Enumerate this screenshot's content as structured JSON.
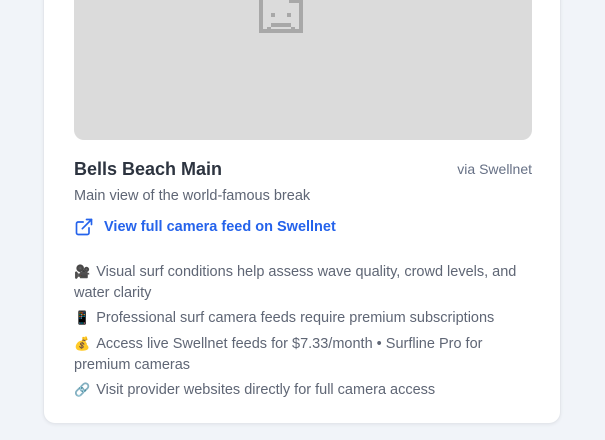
{
  "camera": {
    "name": "Bells Beach Main",
    "provider": "via Swellnet",
    "description": "Main view of the world-famous break",
    "link_label": "View full camera feed on Swellnet"
  },
  "notes": [
    {
      "icon": "video-camera-icon",
      "glyph": "🎥",
      "text": "Visual surf conditions help assess wave quality, crowd levels, and water clarity"
    },
    {
      "icon": "mobile-phone-icon",
      "glyph": "📱",
      "text": "Professional surf camera feeds require premium subscriptions"
    },
    {
      "icon": "money-bag-icon",
      "glyph": "💰",
      "text": "Access live Swellnet feeds for $7.33/month • Surfline Pro for premium cameras"
    },
    {
      "icon": "link-icon",
      "glyph": "🔗",
      "text": "Visit provider websites directly for full camera access"
    }
  ],
  "colors": {
    "accent": "#2563eb",
    "placeholder_bg": "#dbdbdb",
    "title": "#2d3440",
    "muted_text": "#5f6675"
  }
}
